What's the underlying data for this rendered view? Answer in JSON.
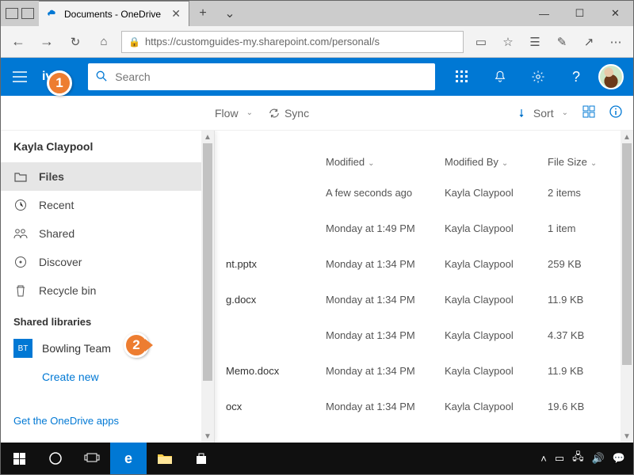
{
  "browser": {
    "tab_title": "Documents - OneDrive",
    "url": "https://customguides-my.sharepoint.com/personal/s"
  },
  "header": {
    "brand_suffix": "ive",
    "search_placeholder": "Search"
  },
  "commandbar": {
    "flow": "Flow",
    "sync": "Sync",
    "sort": "Sort"
  },
  "sidebar": {
    "user": "Kayla Claypool",
    "items": [
      "Files",
      "Recent",
      "Shared",
      "Discover",
      "Recycle bin"
    ],
    "shared_section": "Shared libraries",
    "library": {
      "badge": "BT",
      "name": "Bowling Team"
    },
    "create_new": "Create new",
    "footer_link": "Get the OneDrive apps"
  },
  "table": {
    "headers": {
      "modified": "Modified",
      "modified_by": "Modified By",
      "file_size": "File Size"
    },
    "rows": [
      {
        "name": "",
        "modified": "A few seconds ago",
        "by": "Kayla Claypool",
        "size": "2 items"
      },
      {
        "name": "",
        "modified": "Monday at 1:49 PM",
        "by": "Kayla Claypool",
        "size": "1 item"
      },
      {
        "name": "nt.pptx",
        "modified": "Monday at 1:34 PM",
        "by": "Kayla Claypool",
        "size": "259 KB"
      },
      {
        "name": "g.docx",
        "modified": "Monday at 1:34 PM",
        "by": "Kayla Claypool",
        "size": "11.9 KB"
      },
      {
        "name": "",
        "modified": "Monday at 1:34 PM",
        "by": "Kayla Claypool",
        "size": "4.37 KB"
      },
      {
        "name": "Memo.docx",
        "modified": "Monday at 1:34 PM",
        "by": "Kayla Claypool",
        "size": "11.9 KB"
      },
      {
        "name": "ocx",
        "modified": "Monday at 1:34 PM",
        "by": "Kayla Claypool",
        "size": "19.6 KB"
      }
    ]
  },
  "callouts": {
    "one": "1",
    "two": "2"
  }
}
